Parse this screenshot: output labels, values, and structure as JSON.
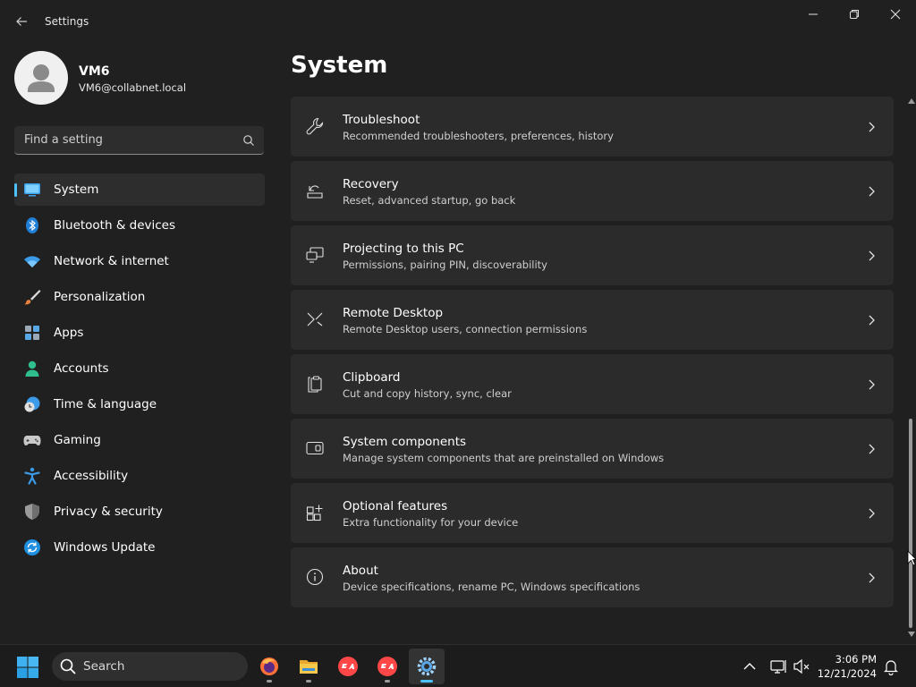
{
  "window": {
    "title": "Settings"
  },
  "profile": {
    "name": "VM6",
    "email": "VM6@collabnet.local"
  },
  "search": {
    "placeholder": "Find a setting"
  },
  "nav": {
    "items": [
      {
        "label": "System",
        "icon": "system-icon",
        "active": true
      },
      {
        "label": "Bluetooth & devices",
        "icon": "bluetooth-icon"
      },
      {
        "label": "Network & internet",
        "icon": "wifi-icon"
      },
      {
        "label": "Personalization",
        "icon": "brush-icon"
      },
      {
        "label": "Apps",
        "icon": "apps-icon"
      },
      {
        "label": "Accounts",
        "icon": "accounts-icon"
      },
      {
        "label": "Time & language",
        "icon": "clock-globe-icon"
      },
      {
        "label": "Gaming",
        "icon": "gamepad-icon"
      },
      {
        "label": "Accessibility",
        "icon": "accessibility-icon"
      },
      {
        "label": "Privacy & security",
        "icon": "shield-icon"
      },
      {
        "label": "Windows Update",
        "icon": "update-icon"
      }
    ]
  },
  "main": {
    "title": "System",
    "cards": [
      {
        "title": "Troubleshoot",
        "subtitle": "Recommended troubleshooters, preferences, history",
        "icon": "wrench-icon"
      },
      {
        "title": "Recovery",
        "subtitle": "Reset, advanced startup, go back",
        "icon": "recovery-icon"
      },
      {
        "title": "Projecting to this PC",
        "subtitle": "Permissions, pairing PIN, discoverability",
        "icon": "projecting-icon"
      },
      {
        "title": "Remote Desktop",
        "subtitle": "Remote Desktop users, connection permissions",
        "icon": "remote-desktop-icon"
      },
      {
        "title": "Clipboard",
        "subtitle": "Cut and copy history, sync, clear",
        "icon": "clipboard-icon"
      },
      {
        "title": "System components",
        "subtitle": "Manage system components that are preinstalled on Windows",
        "icon": "system-components-icon"
      },
      {
        "title": "Optional features",
        "subtitle": "Extra functionality for your device",
        "icon": "optional-features-icon"
      },
      {
        "title": "About",
        "subtitle": "Device specifications, rename PC, Windows specifications",
        "icon": "info-icon"
      }
    ]
  },
  "taskbar": {
    "search_label": "Search",
    "time": "3:06 PM",
    "date": "12/21/2024",
    "apps": [
      "firefox-icon",
      "file-explorer-icon",
      "ea-app-icon",
      "ea-app-icon",
      "settings-gear-icon"
    ]
  },
  "colors": {
    "accent": "#4cc2ff",
    "background": "#202020",
    "card": "#2b2b2b"
  }
}
